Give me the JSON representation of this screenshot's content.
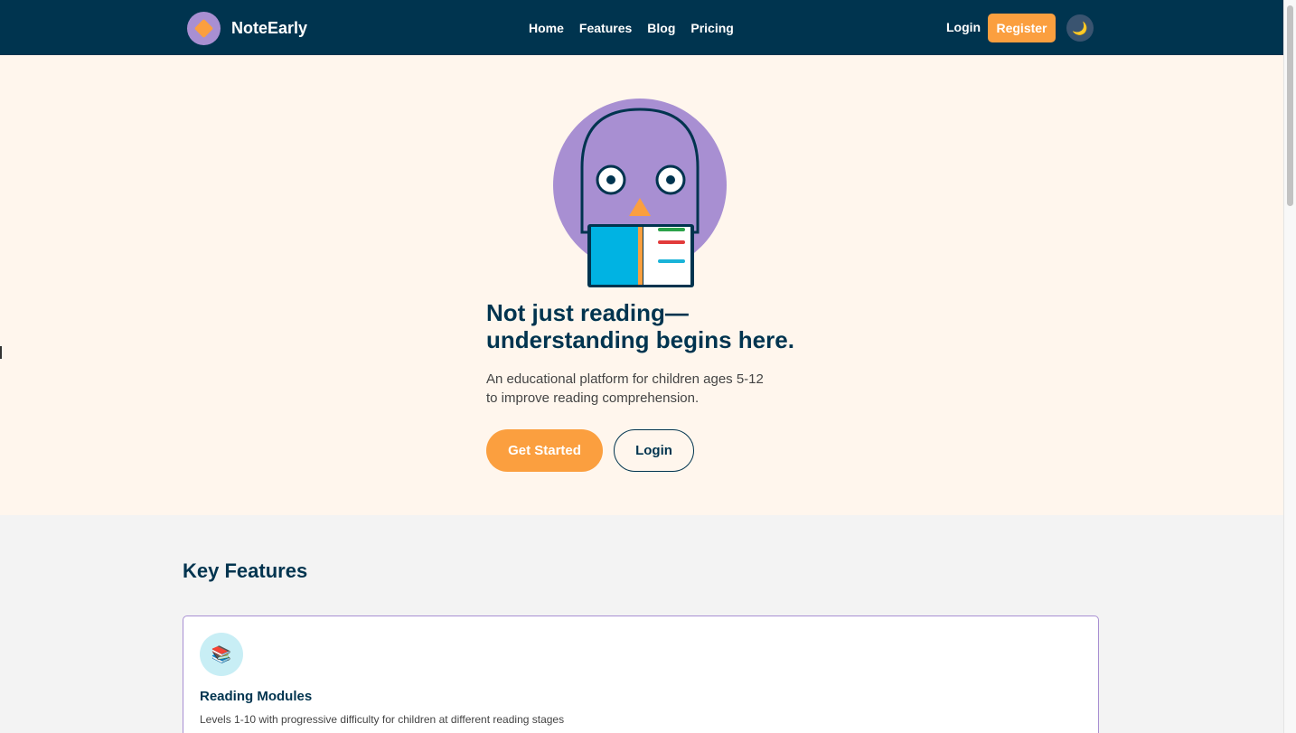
{
  "nav": {
    "brand": "NoteEarly",
    "links": [
      "Home",
      "Features",
      "Blog",
      "Pricing"
    ],
    "login": "Login",
    "register": "Register",
    "theme_icon": "moon-icon",
    "theme_glyph": "🌙"
  },
  "hero": {
    "title": "Not just reading—understanding begins here.",
    "subtitle": "An educational platform for children ages 5-12 to improve reading comprehension.",
    "cta_primary": "Get Started",
    "cta_secondary": "Login"
  },
  "features": {
    "heading": "Key Features",
    "items": [
      {
        "icon": "books-icon",
        "glyph": "📚",
        "title": "Reading Modules",
        "description": "Levels 1-10 with progressive difficulty for children at different reading stages"
      }
    ]
  },
  "colors": {
    "navy": "#00344f",
    "orange": "#fb9f3f",
    "purple": "#a88fd2",
    "cream": "#fff6ed"
  }
}
